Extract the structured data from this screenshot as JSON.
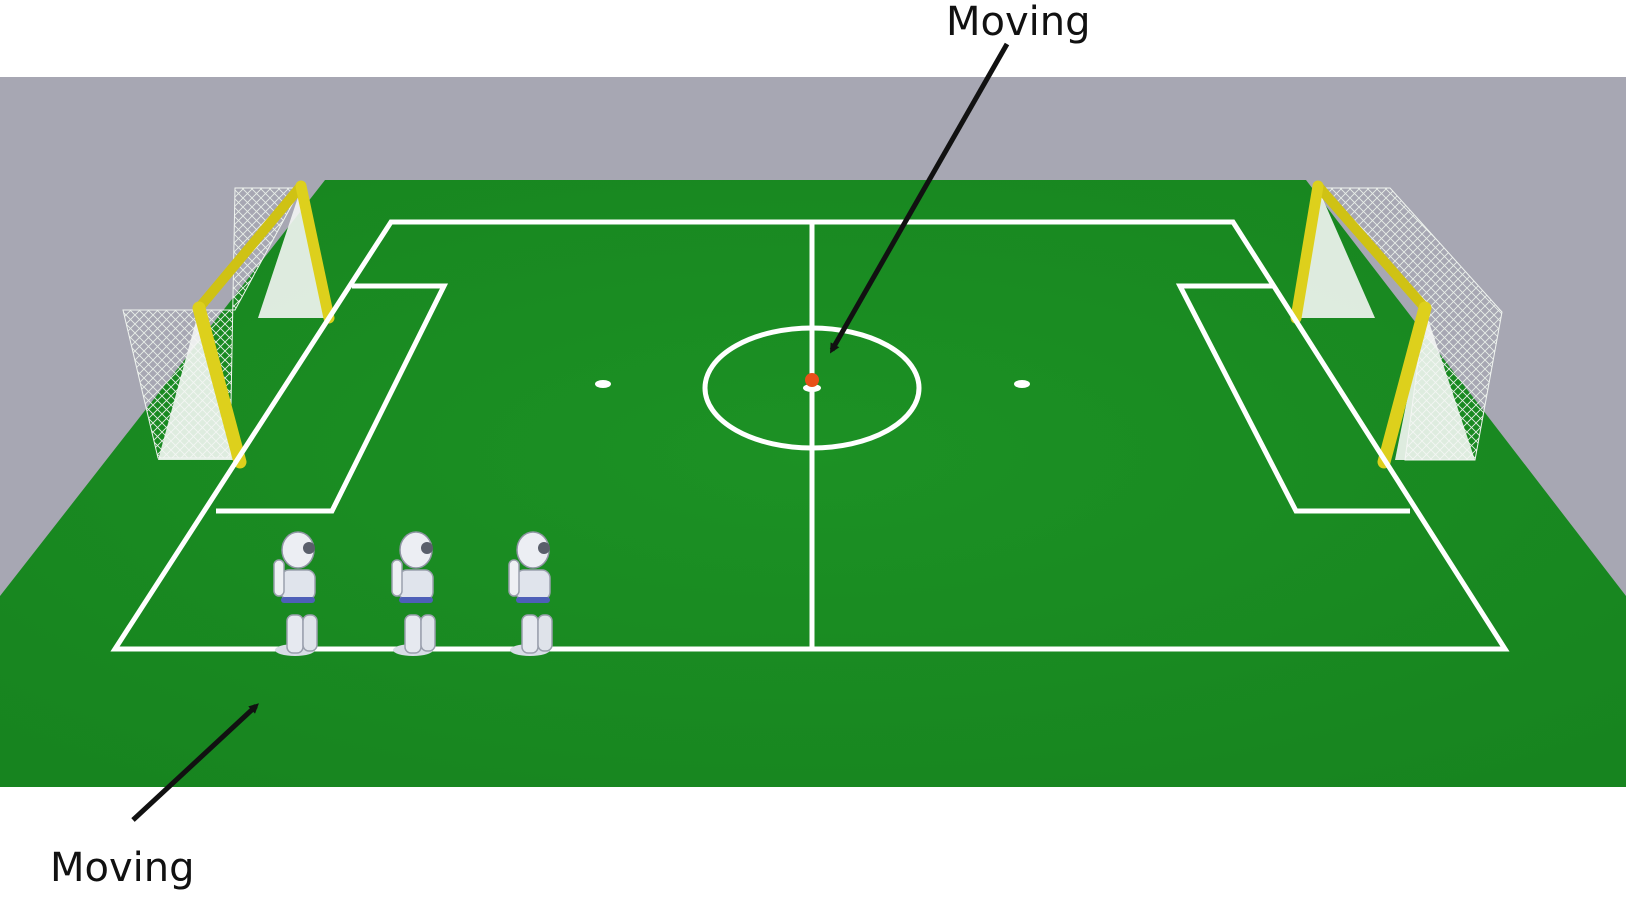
{
  "annotations": {
    "ball_label": "Moving",
    "robots_label": "Moving"
  },
  "colors": {
    "background": "#a7a7b3",
    "field": "#1a8c22",
    "lines": "#ffffff",
    "goal_posts": "#d9cc1a",
    "ball": "#e8501a",
    "arrow": "#111111"
  },
  "scene": {
    "robot_count": 3,
    "goal_count": 2,
    "ball_count": 1
  }
}
